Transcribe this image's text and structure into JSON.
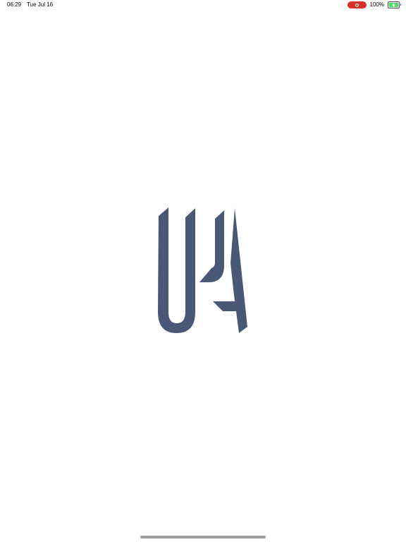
{
  "status_bar": {
    "time": "06:29",
    "date": "Tue Jul 16",
    "battery_percent": "100%",
    "battery_level": 1.0,
    "recording_icon": "screen-recording-icon",
    "charging_icon": "bolt-icon"
  },
  "splash": {
    "logo_icon": "upa-logo"
  },
  "colors": {
    "background": "#ffffff",
    "logo": "#4a5878",
    "recording": "#d9302c",
    "battery_fill": "#4cd964",
    "home_indicator": "#9a9a9a"
  }
}
